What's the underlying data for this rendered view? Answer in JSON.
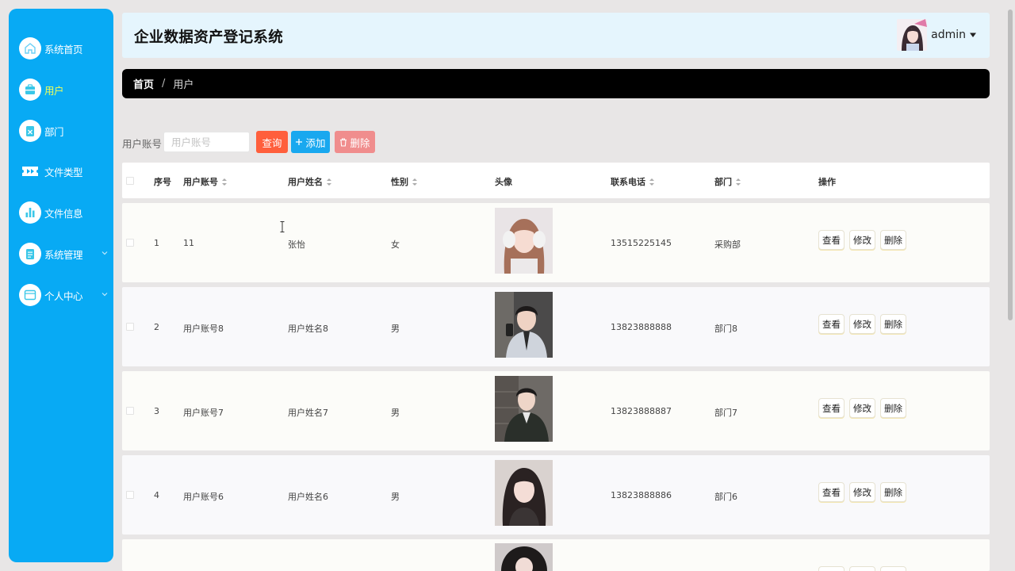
{
  "sidebar": {
    "items": [
      {
        "label": "系统首页",
        "icon": "home-icon"
      },
      {
        "label": "用户",
        "icon": "briefcase-icon",
        "active": true
      },
      {
        "label": "部门",
        "icon": "clipboard-icon"
      },
      {
        "label": "文件类型",
        "icon": "ticket-icon"
      },
      {
        "label": "文件信息",
        "icon": "bar-chart-icon"
      },
      {
        "label": "系统管理",
        "icon": "document-icon",
        "expandable": true
      },
      {
        "label": "个人中心",
        "icon": "window-icon",
        "expandable": true
      }
    ]
  },
  "header": {
    "title": "企业数据资产登记系统",
    "username": "admin"
  },
  "breadcrumb": {
    "home": "首页",
    "separator": "/",
    "current": "用户"
  },
  "search": {
    "label": "用户账号",
    "placeholder": "用户账号",
    "query_label": "查询",
    "add_label": "添加",
    "delete_label": "删除"
  },
  "table": {
    "columns": [
      "序号",
      "用户账号",
      "用户姓名",
      "性别",
      "头像",
      "联系电话",
      "部门",
      "操作"
    ],
    "action_labels": {
      "view": "查看",
      "edit": "修改",
      "delete": "删除"
    },
    "rows": [
      {
        "index": "1",
        "account": "11",
        "name": "张怡",
        "gender": "女",
        "phone": "13515225145",
        "dept": "采购部"
      },
      {
        "index": "2",
        "account": "用户账号8",
        "name": "用户姓名8",
        "gender": "男",
        "phone": "13823888888",
        "dept": "部门8"
      },
      {
        "index": "3",
        "account": "用户账号7",
        "name": "用户姓名7",
        "gender": "男",
        "phone": "13823888887",
        "dept": "部门7"
      },
      {
        "index": "4",
        "account": "用户账号6",
        "name": "用户姓名6",
        "gender": "男",
        "phone": "13823888886",
        "dept": "部门6"
      }
    ]
  },
  "colors": {
    "sidebar_bg": "#08aaf4",
    "active_label": "#f0ff5a",
    "query_button": "#ff5f3c",
    "add_button": "#19a8ef",
    "delete_button": "#f08d8d"
  }
}
